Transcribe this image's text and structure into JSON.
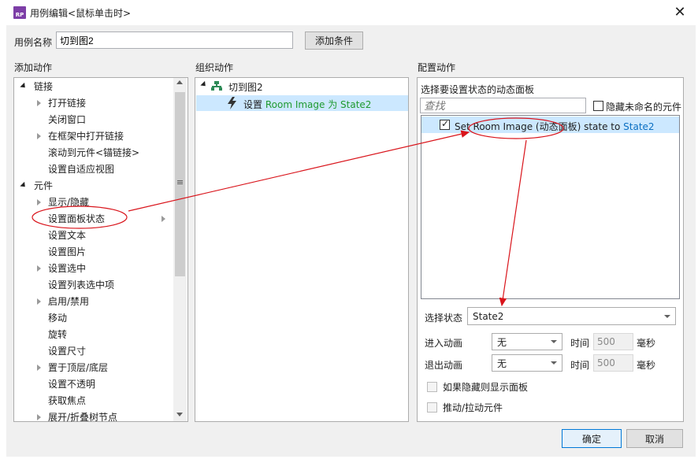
{
  "window": {
    "title": "用例编辑<鼠标单击时>",
    "app_icon_text": "RP",
    "close_glyph": "✕"
  },
  "case_name": {
    "label": "用例名称",
    "value": "切到图2"
  },
  "add_condition_label": "添加条件",
  "add_action": {
    "title": "添加动作",
    "items": [
      {
        "label": "链接"
      },
      {
        "label": "打开链接"
      },
      {
        "label": "关闭窗口"
      },
      {
        "label": "在框架中打开链接"
      },
      {
        "label": "滚动到元件<锚链接>"
      },
      {
        "label": "设置自适应视图"
      },
      {
        "label": "元件"
      },
      {
        "label": "显示/隐藏"
      },
      {
        "label": "设置面板状态"
      },
      {
        "label": "设置文本"
      },
      {
        "label": "设置图片"
      },
      {
        "label": "设置选中"
      },
      {
        "label": "设置列表选中项"
      },
      {
        "label": "启用/禁用"
      },
      {
        "label": "移动"
      },
      {
        "label": "旋转"
      },
      {
        "label": "设置尺寸"
      },
      {
        "label": "置于顶层/底层"
      },
      {
        "label": "设置不透明"
      },
      {
        "label": "获取焦点"
      },
      {
        "label": "展开/折叠树节点"
      }
    ]
  },
  "organize": {
    "title": "组织动作",
    "case_label": "切到图2",
    "action_prefix": "设置",
    "action_target": "Room Image 为 State2"
  },
  "configure": {
    "title": "配置动作",
    "select_panel_label": "选择要设置状态的动态面板",
    "search_placeholder": "查找",
    "hide_unnamed_label": "隐藏未命名的元件",
    "panel_item_prefix": "Set Room Image (动态面板) state to",
    "panel_item_state": "State2",
    "select_state_label": "选择状态",
    "select_state_value": "State2",
    "enter_anim_label": "进入动画",
    "enter_anim_value": "无",
    "exit_anim_label": "退出动画",
    "exit_anim_value": "无",
    "time_label": "时间",
    "time_value": "500",
    "ms_label": "毫秒",
    "show_if_hidden_label": "如果隐藏则显示面板",
    "push_pull_label": "推动/拉动元件"
  },
  "buttons": {
    "ok": "确定",
    "cancel": "取消"
  },
  "colors": {
    "selection": "#cce8ff",
    "annotation": "#d9141b",
    "state_green": "#1f9a2e"
  }
}
